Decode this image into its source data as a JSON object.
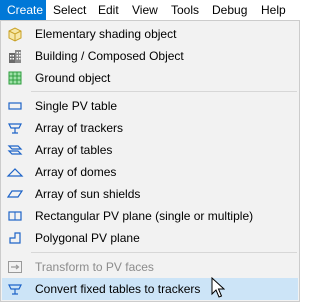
{
  "menubar": {
    "items": [
      {
        "label": "Create",
        "active": true
      },
      {
        "label": "Select"
      },
      {
        "label": "Edit"
      },
      {
        "label": "View"
      },
      {
        "label": "Tools"
      },
      {
        "label": "Debug"
      },
      {
        "label": "Help"
      }
    ]
  },
  "menu": {
    "items": [
      {
        "label": "Elementary shading object",
        "icon": "cube-icon"
      },
      {
        "label": "Building / Composed Object",
        "icon": "building-icon"
      },
      {
        "label": "Ground object",
        "icon": "ground-grid-icon"
      },
      {
        "label": "Single PV table",
        "icon": "pv-table-icon"
      },
      {
        "label": "Array of trackers",
        "icon": "tracker-icon"
      },
      {
        "label": "Array of tables",
        "icon": "tables-icon"
      },
      {
        "label": "Array of domes",
        "icon": "dome-icon"
      },
      {
        "label": "Array of sun shields",
        "icon": "sun-shield-icon"
      },
      {
        "label": "Rectangular PV plane (single or multiple)",
        "icon": "rect-plane-icon"
      },
      {
        "label": "Polygonal PV plane",
        "icon": "polygon-plane-icon"
      },
      {
        "label": "Transform to PV faces",
        "icon": "transform-icon",
        "disabled": true
      },
      {
        "label": "Convert fixed tables to trackers",
        "icon": "tracker-icon",
        "highlighted": true
      }
    ]
  },
  "colors": {
    "accent": "#0078d7",
    "highlight": "#cce4f7",
    "icon_blue": "#1e64c8",
    "icon_gold": "#c9a227",
    "icon_green": "#2e9e3e"
  }
}
